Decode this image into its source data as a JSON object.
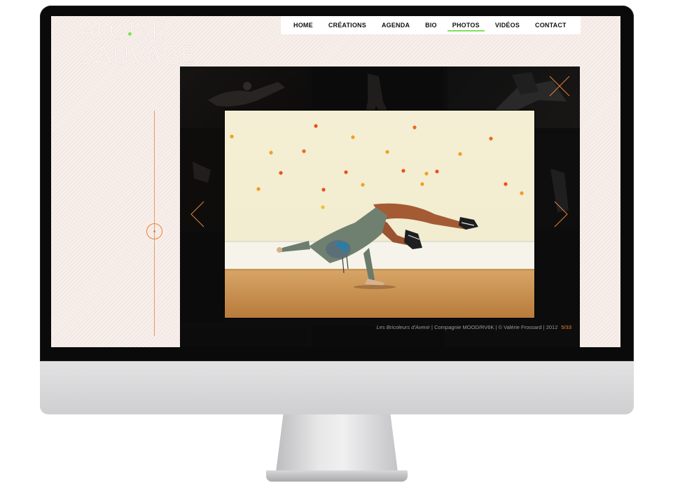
{
  "site": {
    "logo_line1": "ALOISE",
    "logo_line2": "SAUVAGE"
  },
  "nav": {
    "items": [
      "HOME",
      "CRÉATIONS",
      "AGENDA",
      "BIO",
      "PHOTOS",
      "VIDÉOS",
      "CONTACT"
    ],
    "active": "PHOTOS",
    "active_color": "#7fe05a"
  },
  "gallery": {
    "caption_title": "Les Bricoleurs d'Avenir",
    "caption_rest": " | Compagnie MOOD/RV6K | © Valérie Frossard | 2012",
    "counter": "5/33",
    "accent_color": "#e8823a",
    "icons": [
      "close-icon",
      "chevron-left-icon",
      "chevron-right-icon"
    ]
  },
  "colors": {
    "screen_background": "#f7efeb",
    "gallery_background": "#0d0d0d",
    "slider_color": "#e89a62"
  }
}
